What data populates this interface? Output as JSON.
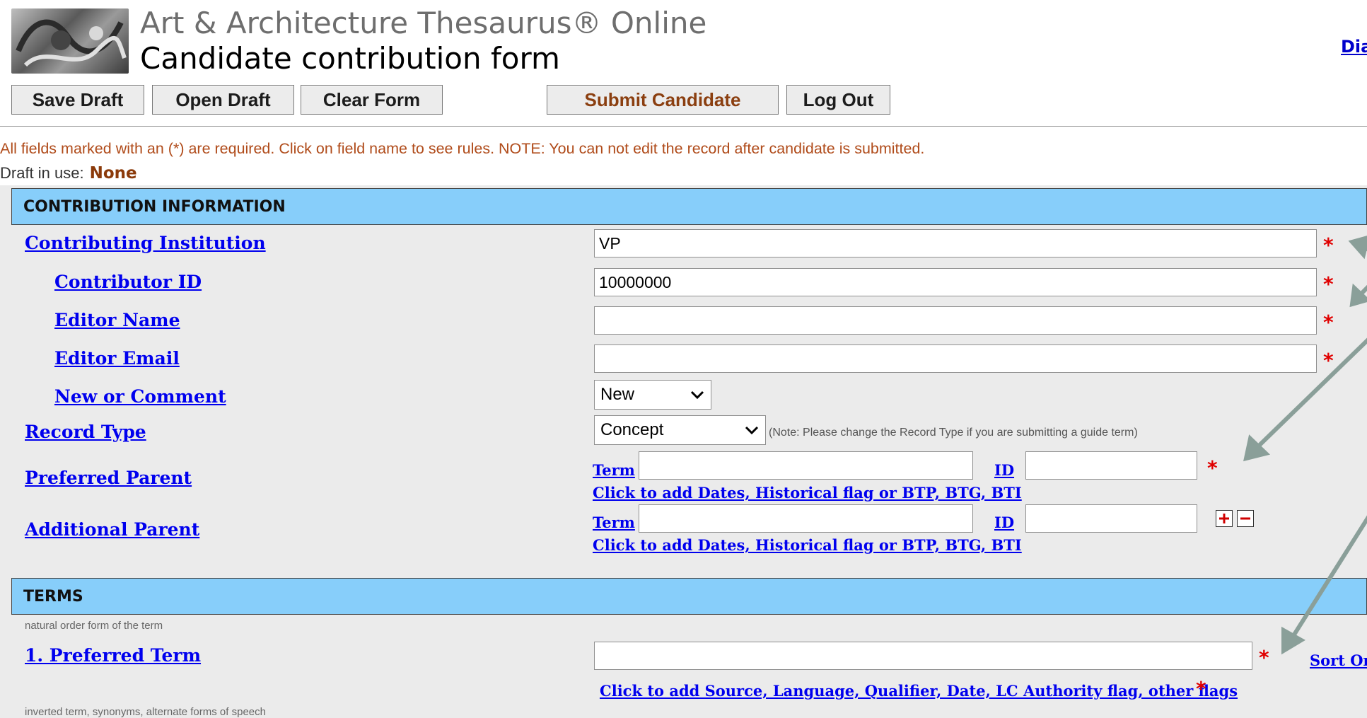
{
  "header": {
    "title": "Art & Architecture Thesaurus® Online",
    "subtitle": "Candidate contribution form",
    "right_link": "Dia"
  },
  "toolbar": {
    "save_draft": "Save Draft",
    "open_draft": "Open Draft",
    "clear_form": "Clear Form",
    "submit_candidate": "Submit Candidate",
    "log_out": "Log Out"
  },
  "notice": "All fields marked with an (*) are required. Click on field name to see rules. NOTE: You can not edit the record after candidate is submitted.",
  "draft": {
    "label": "Draft in use:",
    "value": "None"
  },
  "sections": {
    "contribution": "CONTRIBUTION INFORMATION",
    "terms": "TERMS"
  },
  "fields": {
    "contributing_institution": {
      "label": "Contributing Institution",
      "value": "VP"
    },
    "contributor_id": {
      "label": "Contributor ID",
      "value": "10000000"
    },
    "editor_name": {
      "label": "Editor Name",
      "value": ""
    },
    "editor_email": {
      "label": "Editor Email",
      "value": ""
    },
    "new_or_comment": {
      "label": "New or Comment",
      "selected": "New"
    },
    "record_type": {
      "label": "Record Type",
      "selected": "Concept",
      "note": "(Note: Please change the Record Type if you are submitting a guide term)"
    },
    "preferred_parent": {
      "label": "Preferred Parent",
      "term_label": "Term",
      "id_label": "ID",
      "term_value": "",
      "id_value": "",
      "link": "Click to add Dates, Historical flag or BTP, BTG, BTI"
    },
    "additional_parent": {
      "label": "Additional Parent",
      "term_label": "Term",
      "id_label": "ID",
      "term_value": "",
      "id_value": "",
      "link": "Click to add Dates, Historical flag or BTP, BTG, BTI"
    },
    "preferred_term": {
      "hint": "natural order form of the term",
      "label": "1. Preferred Term",
      "value": "",
      "sort_link": "Sort Or",
      "flags_link": "Click to add Source, Language, Qualifier, Date, LC Authority flag, other flags"
    },
    "next_hint": "inverted term, synonyms, alternate forms of speech"
  },
  "required_mark": "*",
  "colors": {
    "section_bar": "#87cefa",
    "link": "#0000ee",
    "required": "#e00000",
    "notice": "#b04b1a",
    "annotation_arrow": "#8a9f99"
  }
}
